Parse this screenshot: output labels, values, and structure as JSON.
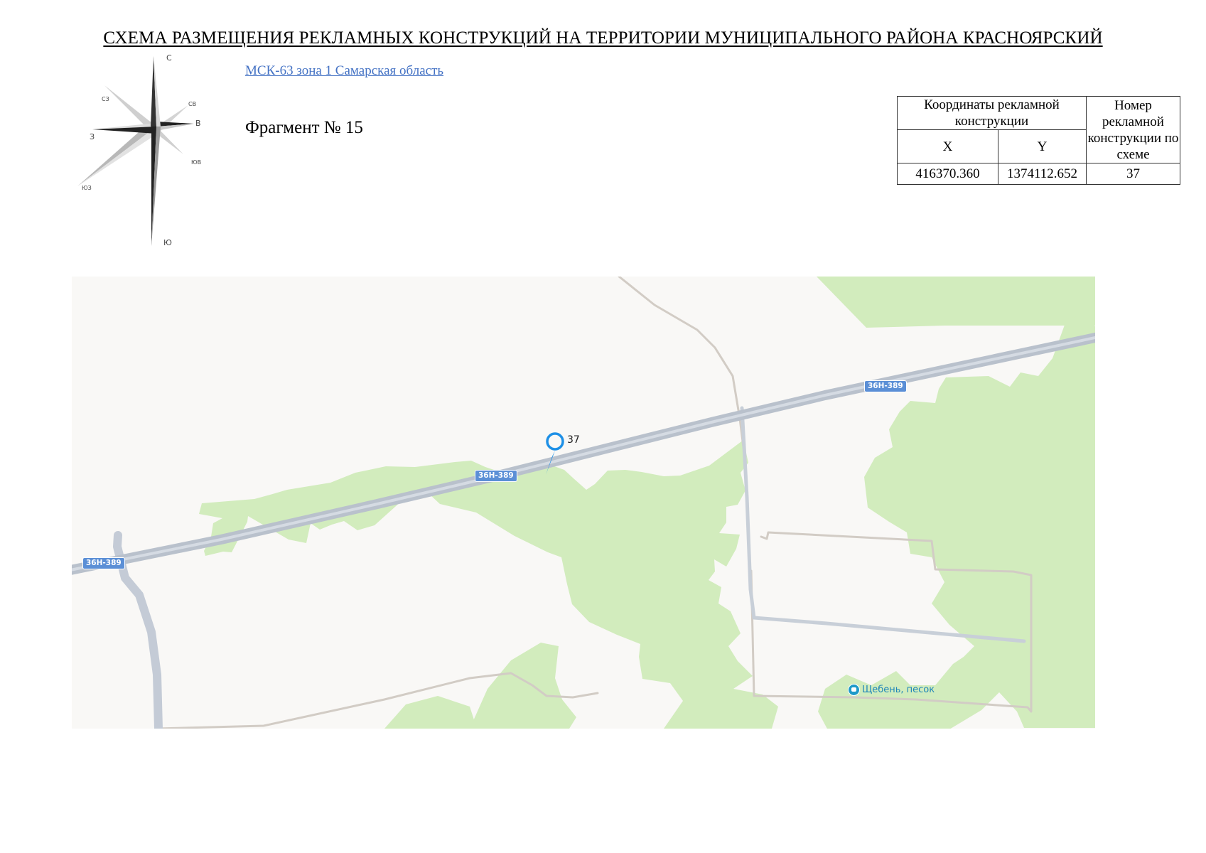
{
  "header": {
    "title": "СХЕМА РАЗМЕЩЕНИЯ РЕКЛАМНЫХ КОНСТРУКЦИЙ НА ТЕРРИТОРИИ МУНИЦИПАЛЬНОГО РАЙОНА КРАСНОЯРСКИЙ",
    "crs_link": "МСК-63 зона 1 Самарская область",
    "fragment": "Фрагмент № 15"
  },
  "compass": {
    "n": "С",
    "ne": "СВ",
    "e": "В",
    "se": "ЮВ",
    "s": "Ю",
    "sw": "ЮЗ",
    "w": "З",
    "nw": "СЗ"
  },
  "table": {
    "coords_header": "Координаты рекламной конструкции",
    "number_header": "Номер рекламной конструкции по схеме",
    "x_header": "X",
    "y_header": "Y",
    "rows": [
      {
        "x": "416370.360",
        "y": "1374112.652",
        "number": "37"
      }
    ]
  },
  "map": {
    "road_label": "36Н-389",
    "marker_label": "37",
    "poi_label": "Щебень, песок",
    "colors": {
      "background": "#f9f8f6",
      "forest": "#d2ecbd",
      "highway": "#c4cbd6",
      "minor_road": "#cdc6bf",
      "shield": "#5b8fd6",
      "marker": "#1e90e6",
      "poi": "#1e86b8"
    }
  }
}
